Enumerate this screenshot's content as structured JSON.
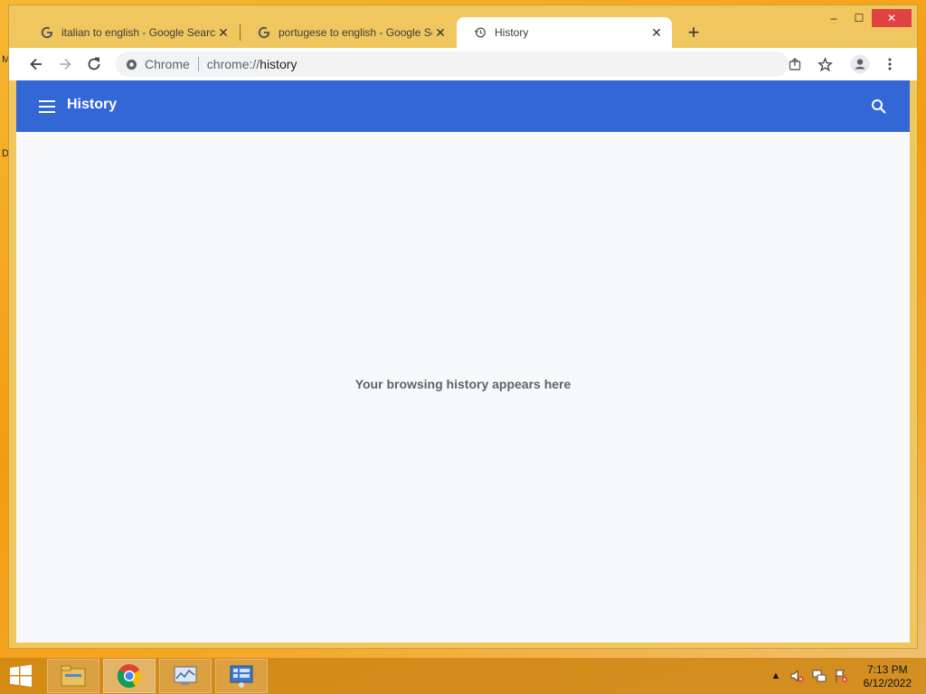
{
  "desktop": {
    "left_glyphs": [
      "M",
      "D"
    ]
  },
  "browser": {
    "tabs": [
      {
        "title": "italian to english - Google Search",
        "favicon": "google-icon"
      },
      {
        "title": "portugese to english - Google Se",
        "favicon": "google-icon"
      },
      {
        "title": "History",
        "favicon": "history-icon",
        "active": true
      }
    ],
    "window_controls": {
      "minimize": "–",
      "maximize": "☐",
      "close": "✕"
    },
    "omnibox": {
      "chip": "Chrome",
      "url_scheme": "chrome://",
      "url_host": "history"
    }
  },
  "history_page": {
    "title": "History",
    "empty_message": "Your browsing history appears here"
  },
  "taskbar": {
    "time": "7:13 PM",
    "date": "6/12/2022"
  },
  "colors": {
    "header_blue": "#3367d6",
    "page_bg": "#f8f9fa",
    "window_frame": "#f0c75e"
  }
}
